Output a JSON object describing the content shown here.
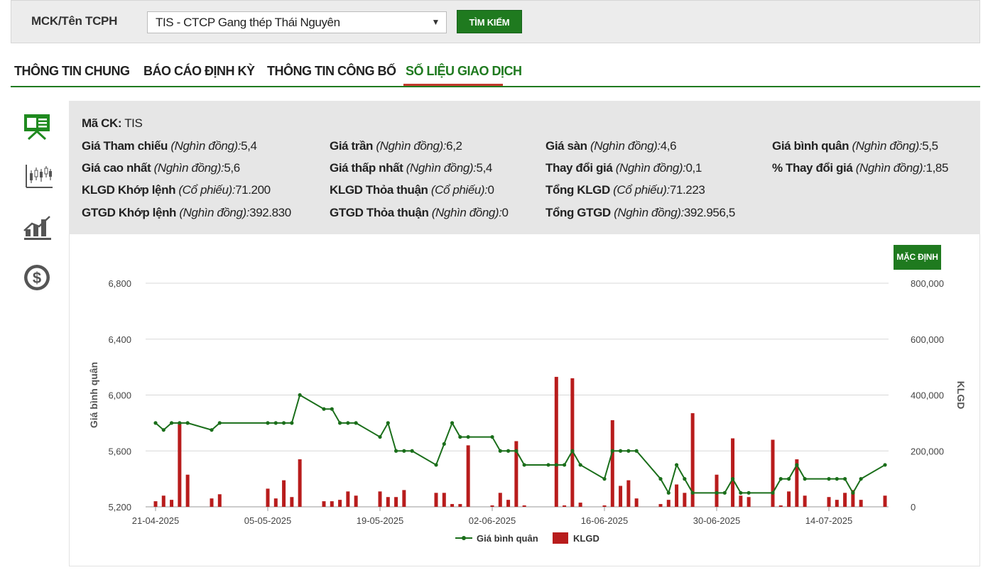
{
  "search": {
    "label": "MCK/Tên TCPH",
    "selected_value": "TIS - CTCP Gang thép Thái Nguyên",
    "button_label": "TÌM KIẾM"
  },
  "tabs": [
    {
      "label": "THÔNG TIN CHUNG",
      "active": false
    },
    {
      "label": "BÁO CÁO ĐỊNH KỲ",
      "active": false
    },
    {
      "label": "THÔNG TIN CÔNG BỐ",
      "active": false
    },
    {
      "label": "SỐ LIỆU GIAO DỊCH",
      "active": true
    }
  ],
  "sidebar": {
    "icons": [
      "presentation-icon",
      "candlestick-chart-icon",
      "bar-chart-icon",
      "dollar-icon"
    ]
  },
  "info": {
    "ticker_label": "Mã CK:",
    "ticker_value": "TIS",
    "unit_vnd": "(Nghìn đồng):",
    "unit_share": "(Cổ phiếu):",
    "ref_price_label": "Giá Tham chiếu",
    "ref_price_value": "5,4",
    "ceiling_label": "Giá trần",
    "ceiling_value": "6,2",
    "floor_label": "Giá sàn",
    "floor_value": "4,6",
    "avg_price_label": "Giá bình quân",
    "avg_price_value": "5,5",
    "high_label": "Giá cao nhất",
    "high_value": "5,6",
    "low_label": "Giá thấp nhất",
    "low_value": "5,4",
    "change_label": "Thay đổi giá",
    "change_value": "0,1",
    "pct_change_label": "% Thay đổi giá",
    "pct_change_value": "1,85",
    "match_vol_label": "KLGD Khớp lệnh",
    "match_vol_value": "71.200",
    "deal_vol_label": "KLGD Thỏa thuận",
    "deal_vol_value": "0",
    "total_vol_label": "Tổng KLGD",
    "total_vol_value": "71.223",
    "match_val_label": "GTGD Khớp lệnh",
    "match_val_value": "392.830",
    "deal_val_label": "GTGD Thỏa thuận",
    "deal_val_value": "0",
    "total_val_label": "Tổng GTGD",
    "total_val_value": "392.956,5"
  },
  "chart_controls": {
    "default_button": "MẶC ĐỊNH"
  },
  "colors": {
    "accent_green": "#1f7a1f",
    "line_green": "#1a6e1a",
    "bar_red": "#b81c1c",
    "tab_underline_red": "#c0392b"
  },
  "chart_data": {
    "type": "bar+line",
    "y_left_label": "Giá bình quân",
    "y_right_label": "KLGD",
    "y_left_ticks": [
      "5,200",
      "5,600",
      "6,000",
      "6,400",
      "6,800"
    ],
    "y_right_ticks": [
      "0",
      "200,000",
      "400,000",
      "600,000",
      "800,000"
    ],
    "y_left_lim": [
      5200,
      6800
    ],
    "y_right_lim": [
      0,
      800000
    ],
    "x_tick_labels": [
      "21-04-2025",
      "05-05-2025",
      "19-05-2025",
      "02-06-2025",
      "16-06-2025",
      "30-06-2025",
      "14-07-2025"
    ],
    "x_tick_days": [
      0,
      14,
      28,
      42,
      56,
      70,
      84
    ],
    "legend": [
      "Giá bình quân",
      "KLGD"
    ],
    "grid": true,
    "dates": [
      "21-04-2025",
      "22-04-2025",
      "23-04-2025",
      "24-04-2025",
      "25-04-2025",
      "28-04-2025",
      "29-04-2025",
      "05-05-2025",
      "06-05-2025",
      "07-05-2025",
      "08-05-2025",
      "09-05-2025",
      "12-05-2025",
      "13-05-2025",
      "14-05-2025",
      "15-05-2025",
      "16-05-2025",
      "19-05-2025",
      "20-05-2025",
      "21-05-2025",
      "22-05-2025",
      "23-05-2025",
      "26-05-2025",
      "27-05-2025",
      "28-05-2025",
      "29-05-2025",
      "30-05-2025",
      "02-06-2025",
      "03-06-2025",
      "04-06-2025",
      "05-06-2025",
      "06-06-2025",
      "09-06-2025",
      "10-06-2025",
      "11-06-2025",
      "12-06-2025",
      "13-06-2025",
      "16-06-2025",
      "17-06-2025",
      "18-06-2025",
      "19-06-2025",
      "20-06-2025",
      "23-06-2025",
      "24-06-2025",
      "25-06-2025",
      "26-06-2025",
      "27-06-2025",
      "30-06-2025",
      "01-07-2025",
      "02-07-2025",
      "03-07-2025",
      "04-07-2025",
      "07-07-2025",
      "08-07-2025",
      "09-07-2025",
      "10-07-2025",
      "11-07-2025",
      "14-07-2025",
      "15-07-2025",
      "16-07-2025",
      "17-07-2025",
      "18-07-2025",
      "21-07-2025"
    ],
    "day_offsets": [
      0,
      1,
      2,
      3,
      4,
      7,
      8,
      14,
      15,
      16,
      17,
      18,
      21,
      22,
      23,
      24,
      25,
      28,
      29,
      30,
      31,
      32,
      35,
      36,
      37,
      38,
      39,
      42,
      43,
      44,
      45,
      46,
      49,
      50,
      51,
      52,
      53,
      56,
      57,
      58,
      59,
      60,
      63,
      64,
      65,
      66,
      67,
      70,
      71,
      72,
      73,
      74,
      77,
      78,
      79,
      80,
      81,
      84,
      85,
      86,
      87,
      88,
      91
    ],
    "avg_price": [
      5800,
      5750,
      5800,
      5800,
      5800,
      5750,
      5800,
      5800,
      5800,
      5800,
      5800,
      6000,
      5900,
      5900,
      5800,
      5800,
      5800,
      5700,
      5800,
      5600,
      5600,
      5600,
      5500,
      5650,
      5800,
      5700,
      5700,
      5700,
      5600,
      5600,
      5600,
      5500,
      5500,
      5500,
      5500,
      5600,
      5500,
      5400,
      5600,
      5600,
      5600,
      5600,
      5400,
      5300,
      5500,
      5400,
      5300,
      5300,
      5300,
      5400,
      5300,
      5300,
      5300,
      5400,
      5400,
      5500,
      5400,
      5400,
      5400,
      5400,
      5300,
      5400,
      5500
    ],
    "volume": [
      20000,
      40000,
      25000,
      300000,
      115000,
      30000,
      45000,
      65000,
      30000,
      95000,
      35000,
      170000,
      20000,
      20000,
      25000,
      55000,
      40000,
      55000,
      35000,
      35000,
      60000,
      0,
      50000,
      50000,
      10000,
      10000,
      220000,
      5000,
      50000,
      25000,
      235000,
      5000,
      0,
      465000,
      5000,
      460000,
      15000,
      5000,
      310000,
      75000,
      95000,
      30000,
      10000,
      25000,
      80000,
      50000,
      335000,
      115000,
      0,
      245000,
      40000,
      35000,
      240000,
      5000,
      55000,
      170000,
      40000,
      35000,
      25000,
      50000,
      60000,
      25000,
      40000
    ]
  }
}
